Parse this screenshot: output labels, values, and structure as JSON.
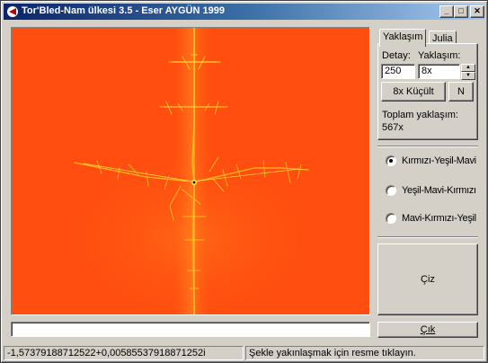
{
  "window": {
    "title": "Tor'Bled-Nam ülkesi 3.5 - Eser AYGÜN 1999",
    "buttons": {
      "minimize": "_",
      "maximize": "□",
      "close": "✕"
    }
  },
  "tabs": [
    {
      "label": "Yaklaşım",
      "active": true
    },
    {
      "label": "Julia",
      "active": false
    }
  ],
  "zoom_panel": {
    "detail_label": "Detay:",
    "zoom_label": "Yaklaşım:",
    "detail_value": "250",
    "zoom_value": "8x",
    "shrink_button": "8x Küçült",
    "n_button": "N",
    "total_label": "Toplam yaklaşım:",
    "total_value": "567x"
  },
  "color_scheme": {
    "options": [
      "Kırmızı-Yeşil-Mavi",
      "Yeşil-Mavi-Kırmızı",
      "Mavi-Kırmızı-Yeşil"
    ],
    "selected": "Kırmızı-Yeşil-Mavi"
  },
  "buttons": {
    "draw": "Çiz",
    "exit": "Çık"
  },
  "status": {
    "coordinates": "-1,57379188712522+0,00585537918871252i",
    "hint": "Şekle yakınlaşmak için resme tıklayın."
  },
  "colors": {
    "fractal_background": "#ff4e10",
    "fractal_filament": "#ffd21a",
    "fractal_glow": "#ff7a1a",
    "title_bar": "#0a246a"
  },
  "icons": {
    "app": "app-icon"
  }
}
